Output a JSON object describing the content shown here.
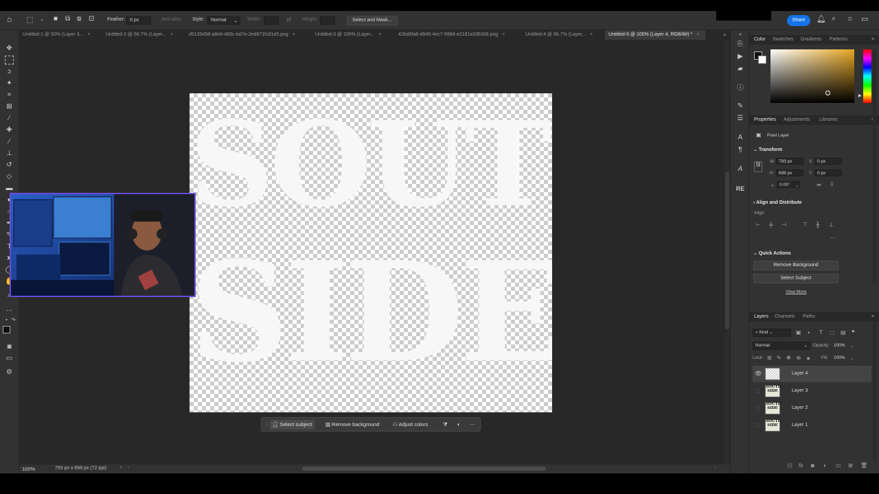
{
  "options_bar": {
    "feather_label": "Feather:",
    "feather_value": "0 px",
    "antialias_label": "Anti-alias",
    "style_label": "Style:",
    "style_value": "Normal",
    "width_label": "Width:",
    "height_label": "Height:",
    "select_mask_label": "Select and Mask...",
    "share_label": "Share"
  },
  "tabs": [
    {
      "label": "Untitled-1 @ 50% (Layer 3...",
      "active": false
    },
    {
      "label": "Untitled-2 @ 66.7% (Layer...",
      "active": false
    },
    {
      "label": "d5135458-a8e8-483c-bd7e-2ed871fc81e5.png",
      "active": false
    },
    {
      "label": "Untitled-3 @ 100% (Layer...",
      "active": false
    },
    {
      "label": "42bd8fa8-d945-4ec7-998d-e2181a336338.png",
      "active": false
    },
    {
      "label": "Untitled-4 @ 66.7% (Layer...",
      "active": false
    },
    {
      "label": "Untitled-5 @ 100% (Layer 4, RGB/8#) *",
      "active": true
    }
  ],
  "canvas": {
    "line1": "SOUTH",
    "line2": "SIDE"
  },
  "context_bar": {
    "select_subject": "Select subject",
    "remove_background": "Remove background",
    "adjust_colors": "Adjust colors"
  },
  "status": {
    "zoom": "100%",
    "dimensions": "793 px x 698 px (72 ppi)"
  },
  "color_panel": {
    "tabs": [
      "Color",
      "Swatches",
      "Gradients",
      "Patterns"
    ],
    "picker_hue": "#e6a620"
  },
  "properties_panel": {
    "tabs": [
      "Properties",
      "Adjustments",
      "Libraries"
    ],
    "layer_type": "Pixel Layer",
    "transform_title": "Transform",
    "w_label": "W",
    "w_value": "793 px",
    "h_label": "H",
    "h_value": "698 px",
    "x_label": "X",
    "x_value": "0 px",
    "y_label": "Y",
    "y_value": "0 px",
    "angle_value": "0.00°",
    "align_title": "Align and Distribute",
    "align_label": "Align:",
    "quick_actions_title": "Quick Actions",
    "remove_bg_button": "Remove Background",
    "select_subject_button": "Select Subject",
    "view_more_link": "View More"
  },
  "layers_panel": {
    "tabs": [
      "Layers",
      "Channels",
      "Paths"
    ],
    "kind_label": "Kind",
    "blend_mode": "Normal",
    "opacity_label": "Opacity:",
    "opacity_value": "100%",
    "lock_label": "Lock:",
    "fill_label": "Fill:",
    "fill_value": "100%",
    "layers": [
      {
        "name": "Layer 4",
        "selected": true,
        "visible": true
      },
      {
        "name": "Layer 3",
        "selected": false,
        "visible": false
      },
      {
        "name": "Layer 2",
        "selected": false,
        "visible": false
      },
      {
        "name": "Layer 1",
        "selected": false,
        "visible": false
      }
    ],
    "thumb_text_1": "SOUTH",
    "thumb_text_2": "SIDE"
  },
  "colors": {
    "accent": "#1473e6",
    "webcam_border": "#6a4bd6"
  }
}
